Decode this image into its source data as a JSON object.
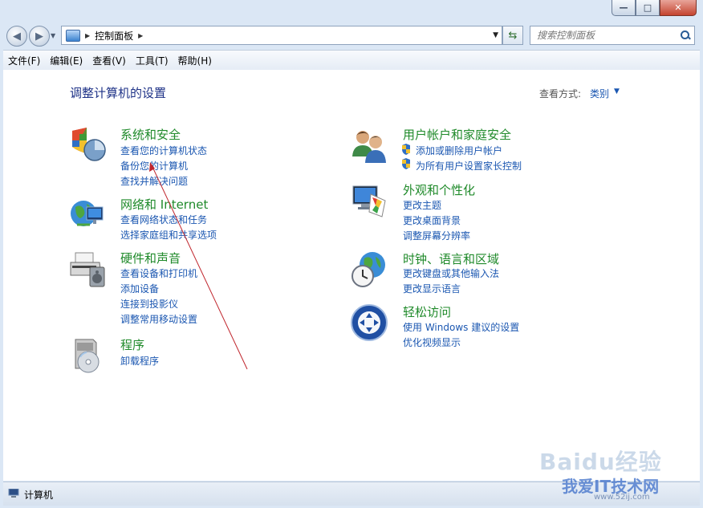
{
  "address_bar": {
    "breadcrumb": "控制面板",
    "search_placeholder": "搜索控制面板"
  },
  "menubar": [
    "文件(F)",
    "编辑(E)",
    "查看(V)",
    "工具(T)",
    "帮助(H)"
  ],
  "content": {
    "title": "调整计算机的设置",
    "view_by_label": "查看方式:",
    "view_by_value": "类别",
    "left_categories": [
      {
        "title": "系统和安全",
        "icon": "system-security-icon",
        "links": [
          "查看您的计算机状态",
          "备份您的计算机",
          "查找并解决问题"
        ]
      },
      {
        "title": "网络和 Internet",
        "icon": "network-globe-icon",
        "links": [
          "查看网络状态和任务",
          "选择家庭组和共享选项"
        ]
      },
      {
        "title": "硬件和声音",
        "icon": "printer-hardware-icon",
        "links": [
          "查看设备和打印机",
          "添加设备",
          "连接到投影仪",
          "调整常用移动设置"
        ]
      },
      {
        "title": "程序",
        "icon": "programs-disc-icon",
        "links": [
          "卸载程序"
        ]
      }
    ],
    "right_categories": [
      {
        "title": "用户帐户和家庭安全",
        "icon": "user-accounts-icon",
        "links": [
          "添加或删除用户帐户",
          "为所有用户设置家长控制"
        ]
      },
      {
        "title": "外观和个性化",
        "icon": "appearance-monitor-icon",
        "links": [
          "更改主题",
          "更改桌面背景",
          "调整屏幕分辨率"
        ]
      },
      {
        "title": "时钟、语言和区域",
        "icon": "clock-globe-icon",
        "links": [
          "更改键盘或其他输入法",
          "更改显示语言"
        ]
      },
      {
        "title": "轻松访问",
        "icon": "ease-of-access-icon",
        "links": [
          "使用 Windows 建议的设置",
          "优化视频显示"
        ]
      }
    ]
  },
  "statusbar": {
    "text": "计算机"
  },
  "watermark": {
    "logo": "Baidu经验",
    "brand": "我爱IT技术网",
    "url": "www.52ij.com"
  },
  "colors": {
    "category_title": "#1f8a2a",
    "link": "#1b57b1",
    "page_title": "#1e3287",
    "annotation_arrow": "#c0262d"
  }
}
